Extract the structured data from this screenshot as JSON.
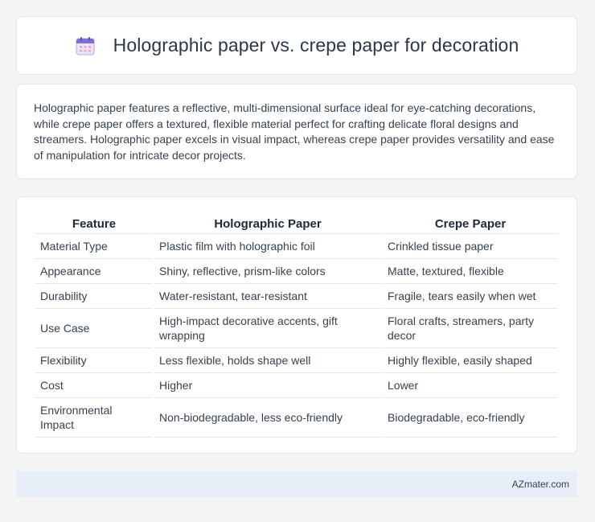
{
  "header": {
    "title": "Holographic paper vs. crepe paper for decoration",
    "icon": "calendar-icon"
  },
  "intro": {
    "text": "Holographic paper features a reflective, multi-dimensional surface ideal for eye-catching decorations, while crepe paper offers a textured, flexible material perfect for crafting delicate floral designs and streamers. Holographic paper excels in visual impact, whereas crepe paper provides versatility and ease of manipulation for intricate decor projects."
  },
  "table": {
    "headers": [
      "Feature",
      "Holographic Paper",
      "Crepe Paper"
    ],
    "rows": [
      [
        "Material Type",
        "Plastic film with holographic foil",
        "Crinkled tissue paper"
      ],
      [
        "Appearance",
        "Shiny, reflective, prism-like colors",
        "Matte, textured, flexible"
      ],
      [
        "Durability",
        "Water-resistant, tear-resistant",
        "Fragile, tears easily when wet"
      ],
      [
        "Use Case",
        "High-impact decorative accents, gift wrapping",
        "Floral crafts, streamers, party decor"
      ],
      [
        "Flexibility",
        "Less flexible, holds shape well",
        "Highly flexible, easily shaped"
      ],
      [
        "Cost",
        "Higher",
        "Lower"
      ],
      [
        "Environmental Impact",
        "Non-biodegradable, less eco-friendly",
        "Biodegradable, eco-friendly"
      ]
    ]
  },
  "footer": {
    "brand": "AZmater.com"
  }
}
